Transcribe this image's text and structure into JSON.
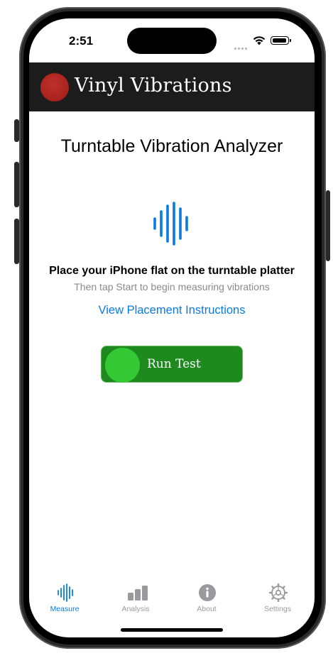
{
  "status_bar": {
    "time": "2:51"
  },
  "header": {
    "app_title": "Vinyl Vibrations",
    "logo_color": "#b02622",
    "background": "#1c1c1c"
  },
  "main": {
    "page_title": "Turntable Vibration Analyzer",
    "icon": "waveform-icon",
    "instruction_main": "Place your iPhone flat on the turntable platter",
    "instruction_sub": "Then tap Start to begin measuring vibrations",
    "placement_link": "View Placement Instructions",
    "run_test_label": "Run Test",
    "accent_color": "#0a7be0",
    "button_color": "#1e8a1e"
  },
  "tab_bar": {
    "tabs": [
      {
        "label": "Measure",
        "icon": "waveform-icon",
        "active": true
      },
      {
        "label": "Analysis",
        "icon": "bar-chart-icon",
        "active": false
      },
      {
        "label": "About",
        "icon": "info-icon",
        "active": false
      },
      {
        "label": "Settings",
        "icon": "gear-icon",
        "active": false
      }
    ]
  }
}
